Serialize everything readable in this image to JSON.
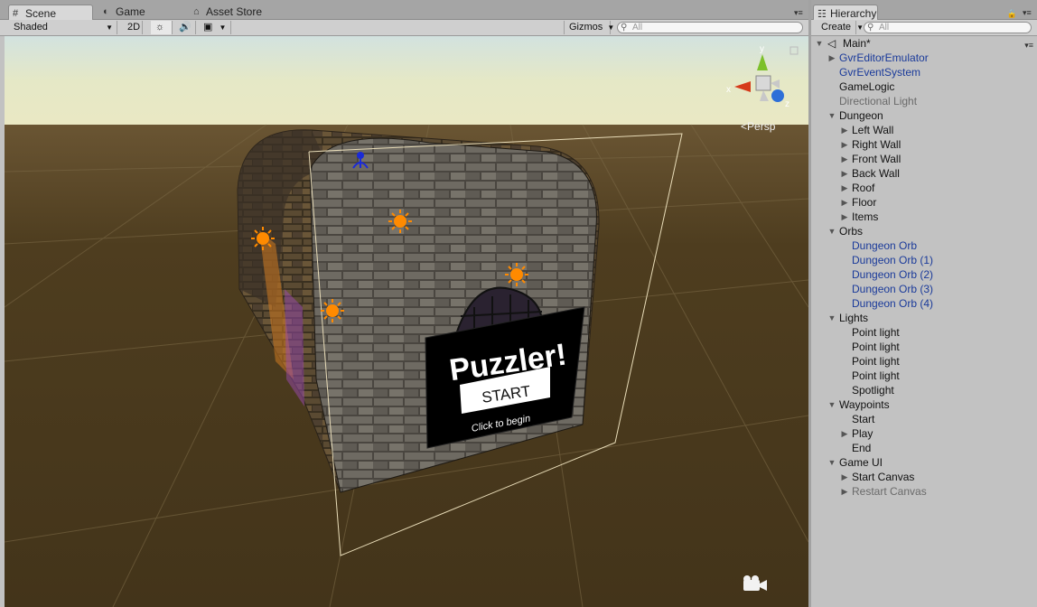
{
  "scene": {
    "tabs": [
      {
        "label": "Scene",
        "icon": "grid-icon"
      },
      {
        "label": "Game",
        "icon": "game-controller-icon"
      },
      {
        "label": "Asset Store",
        "icon": "store-icon"
      }
    ],
    "toolbar": {
      "shading_mode": "Shaded",
      "twod_label": "2D",
      "gizmos_label": "Gizmos",
      "search_placeholder": "All"
    },
    "viewport": {
      "gizmo_axes": {
        "x": "x",
        "y": "y",
        "z": "z"
      },
      "projection_label": "Persp",
      "game_ui": {
        "title": "Puzzler!",
        "button": "START",
        "hint": "Click to begin"
      }
    }
  },
  "hierarchy": {
    "tab_label": "Hierarchy",
    "create_label": "Create",
    "search_placeholder": "All",
    "scene_name": "Main*",
    "items": [
      {
        "label": "GvrEditorEmulator",
        "depth": 1,
        "arrow": "collapsed",
        "color": "blue"
      },
      {
        "label": "GvrEventSystem",
        "depth": 1,
        "arrow": "none",
        "color": "blue"
      },
      {
        "label": "GameLogic",
        "depth": 1,
        "arrow": "none",
        "color": "black"
      },
      {
        "label": "Directional Light",
        "depth": 1,
        "arrow": "none",
        "color": "gray"
      },
      {
        "label": "Dungeon",
        "depth": 1,
        "arrow": "expanded",
        "color": "black"
      },
      {
        "label": "Left Wall",
        "depth": 2,
        "arrow": "collapsed",
        "color": "black"
      },
      {
        "label": "Right Wall",
        "depth": 2,
        "arrow": "collapsed",
        "color": "black"
      },
      {
        "label": "Front Wall",
        "depth": 2,
        "arrow": "collapsed",
        "color": "black"
      },
      {
        "label": "Back Wall",
        "depth": 2,
        "arrow": "collapsed",
        "color": "black"
      },
      {
        "label": "Roof",
        "depth": 2,
        "arrow": "collapsed",
        "color": "black"
      },
      {
        "label": "Floor",
        "depth": 2,
        "arrow": "collapsed",
        "color": "black"
      },
      {
        "label": "Items",
        "depth": 2,
        "arrow": "collapsed",
        "color": "black"
      },
      {
        "label": "Orbs",
        "depth": 1,
        "arrow": "expanded",
        "color": "black"
      },
      {
        "label": "Dungeon Orb",
        "depth": 2,
        "arrow": "none",
        "color": "blue"
      },
      {
        "label": "Dungeon Orb (1)",
        "depth": 2,
        "arrow": "none",
        "color": "blue"
      },
      {
        "label": "Dungeon Orb (2)",
        "depth": 2,
        "arrow": "none",
        "color": "blue"
      },
      {
        "label": "Dungeon Orb (3)",
        "depth": 2,
        "arrow": "none",
        "color": "blue"
      },
      {
        "label": "Dungeon Orb (4)",
        "depth": 2,
        "arrow": "none",
        "color": "blue"
      },
      {
        "label": "Lights",
        "depth": 1,
        "arrow": "expanded",
        "color": "black"
      },
      {
        "label": "Point light",
        "depth": 2,
        "arrow": "none",
        "color": "black"
      },
      {
        "label": "Point light",
        "depth": 2,
        "arrow": "none",
        "color": "black"
      },
      {
        "label": "Point light",
        "depth": 2,
        "arrow": "none",
        "color": "black"
      },
      {
        "label": "Point light",
        "depth": 2,
        "arrow": "none",
        "color": "black"
      },
      {
        "label": "Spotlight",
        "depth": 2,
        "arrow": "none",
        "color": "black"
      },
      {
        "label": "Waypoints",
        "depth": 1,
        "arrow": "expanded",
        "color": "black"
      },
      {
        "label": "Start",
        "depth": 2,
        "arrow": "none",
        "color": "black"
      },
      {
        "label": "Play",
        "depth": 2,
        "arrow": "collapsed",
        "color": "black"
      },
      {
        "label": "End",
        "depth": 2,
        "arrow": "none",
        "color": "black"
      },
      {
        "label": "Game UI",
        "depth": 1,
        "arrow": "expanded",
        "color": "black"
      },
      {
        "label": "Start Canvas",
        "depth": 2,
        "arrow": "collapsed",
        "color": "black"
      },
      {
        "label": "Restart Canvas",
        "depth": 2,
        "arrow": "collapsed",
        "color": "gray"
      }
    ]
  },
  "colors": {
    "sky_top": "#e4ead0",
    "ground": "#4a3a1c",
    "light_gizmo": "#ff8a00",
    "axis_x": "#d63a1a",
    "axis_y": "#7cc02a",
    "axis_z": "#2e6fd8",
    "object_blue": "#1a3a9a"
  }
}
